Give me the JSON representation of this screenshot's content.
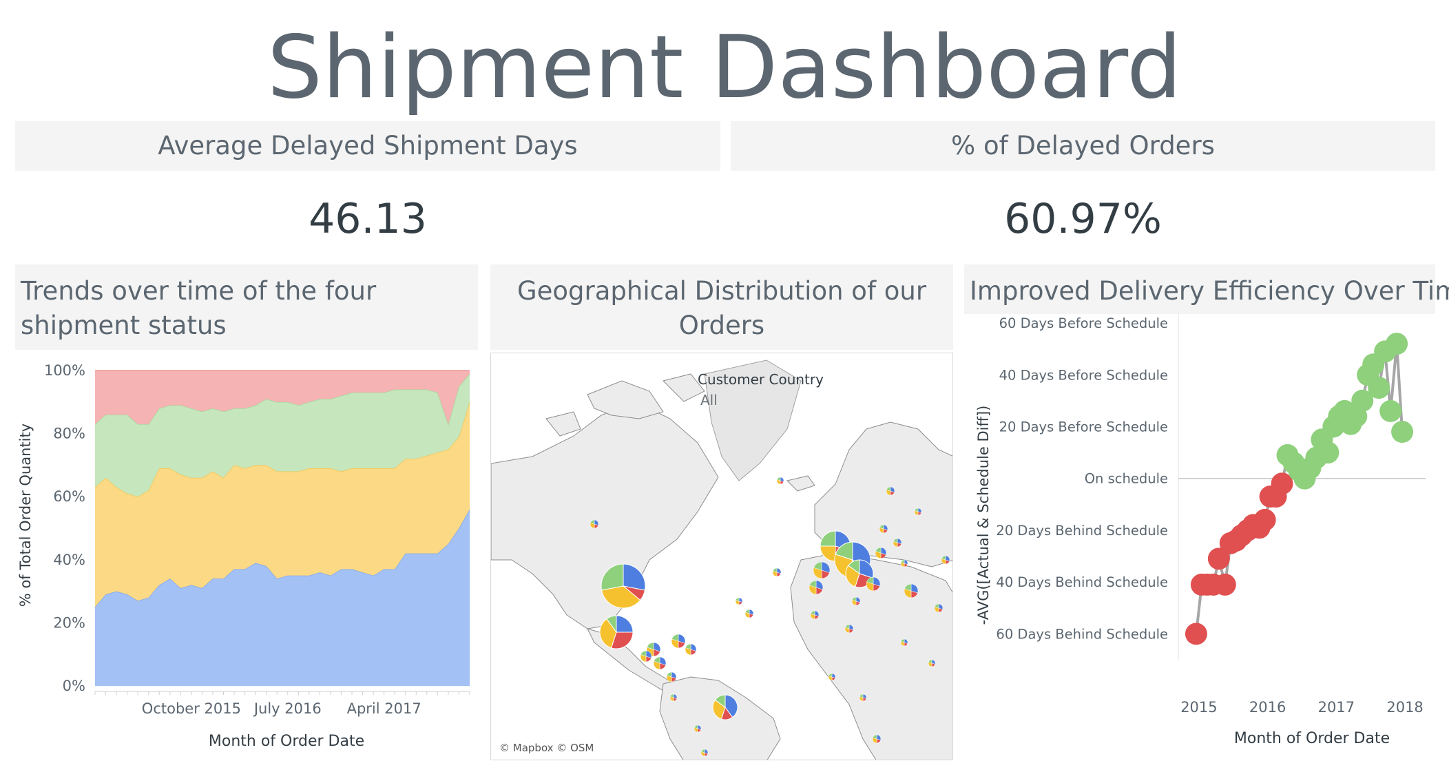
{
  "dashboard": {
    "title": "Shipment Dashboard"
  },
  "kpis": {
    "avg_delay": {
      "label": "Average Delayed Shipment Days",
      "value": "46.13"
    },
    "pct_delayed": {
      "label": "% of Delayed Orders",
      "value": "60.97%"
    }
  },
  "panels": {
    "trends": {
      "title": "Trends over time of the four shipment status"
    },
    "geo": {
      "title": "Geographical Distribution of our Orders"
    },
    "efficiency": {
      "title": "Improved Delivery Efficiency Over Time"
    }
  },
  "map": {
    "legend_title": "Customer Country",
    "legend_value": "All",
    "attribution": "© Mapbox © OSM",
    "slice_colors": [
      "#4e7fe0",
      "#e05050",
      "#f5c12e",
      "#8ed07c"
    ]
  },
  "chart_data": [
    {
      "type": "area",
      "stacked": true,
      "normalized": true,
      "ylabel": "% of Total Order Quantity",
      "xlabel": "Month of Order Date",
      "ylim": [
        0,
        100
      ],
      "yticks": [
        "0%",
        "20%",
        "40%",
        "60%",
        "80%",
        "100%"
      ],
      "xticks": [
        {
          "label": "October 2015",
          "index": 9
        },
        {
          "label": "July 2016",
          "index": 18
        },
        {
          "label": "April 2017",
          "index": 27
        }
      ],
      "n_points": 36,
      "series": [
        {
          "color": "#a3c1f5",
          "edge": "#7fa6ee",
          "values": [
            25,
            29,
            30,
            29,
            27,
            28,
            32,
            34,
            31,
            32,
            31,
            34,
            34,
            37,
            37,
            39,
            38,
            34,
            35,
            35,
            35,
            36,
            35,
            37,
            37,
            36,
            35,
            37,
            37,
            42,
            42,
            42,
            42,
            45,
            50,
            56
          ]
        },
        {
          "color": "#fbd985",
          "edge": "#f5c653",
          "values": [
            38,
            37,
            33,
            32,
            33,
            34,
            37,
            35,
            36,
            34,
            35,
            34,
            32,
            33,
            32,
            31,
            32,
            34,
            33,
            33,
            34,
            33,
            34,
            31,
            32,
            33,
            34,
            32,
            32,
            30,
            30,
            31,
            32,
            30,
            29,
            34
          ]
        },
        {
          "color": "#c6e6bd",
          "edge": "#a7d69b",
          "values": [
            20,
            20,
            23,
            25,
            23,
            21,
            19,
            20,
            22,
            22,
            21,
            20,
            21,
            18,
            19,
            19,
            21,
            22,
            22,
            21,
            21,
            22,
            22,
            24,
            24,
            24,
            24,
            24,
            25,
            22,
            22,
            21,
            19,
            8,
            16,
            9
          ]
        },
        {
          "color": "#f5b3b3",
          "edge": "#e89a9a",
          "values": [
            17,
            14,
            14,
            14,
            17,
            17,
            12,
            11,
            11,
            12,
            13,
            12,
            13,
            12,
            12,
            11,
            9,
            10,
            10,
            11,
            10,
            9,
            9,
            8,
            7,
            7,
            7,
            7,
            6,
            6,
            6,
            6,
            7,
            17,
            5,
            1
          ]
        }
      ],
      "grid": true
    },
    {
      "type": "scatter",
      "connected": true,
      "ylabel": "-AVG([Actual & Schedule Diff])",
      "xlabel": "Month of Order Date",
      "xticks": [
        {
          "label": "2015",
          "value": 2015.0
        },
        {
          "label": "2016",
          "value": 2016.0
        },
        {
          "label": "2017",
          "value": 2017.0
        },
        {
          "label": "2018",
          "value": 2018.0
        }
      ],
      "xlim": [
        2014.7,
        2018.3
      ],
      "yticks": [
        {
          "label": "60 Days Before Schedule",
          "value": 60
        },
        {
          "label": "40 Days Before Schedule",
          "value": 40
        },
        {
          "label": "20 Days Before Schedule",
          "value": 20
        },
        {
          "label": "On schedule",
          "value": 0
        },
        {
          "label": "20 Days Behind Schedule",
          "value": -20
        },
        {
          "label": "40 Days Behind Schedule",
          "value": -40
        },
        {
          "label": "60 Days Behind Schedule",
          "value": -60
        }
      ],
      "ylim": [
        -70,
        64
      ],
      "colors": {
        "positive": "#8ed07c",
        "negative": "#e05050",
        "line": "#a6a6a6",
        "zero": "#c8c8c8"
      },
      "points": [
        {
          "x": 2014.96,
          "y": -60
        },
        {
          "x": 2015.04,
          "y": -41
        },
        {
          "x": 2015.12,
          "y": -41
        },
        {
          "x": 2015.21,
          "y": -41
        },
        {
          "x": 2015.29,
          "y": -31
        },
        {
          "x": 2015.38,
          "y": -41
        },
        {
          "x": 2015.46,
          "y": -25
        },
        {
          "x": 2015.54,
          "y": -24
        },
        {
          "x": 2015.62,
          "y": -22
        },
        {
          "x": 2015.71,
          "y": -20
        },
        {
          "x": 2015.79,
          "y": -18
        },
        {
          "x": 2015.88,
          "y": -19
        },
        {
          "x": 2015.96,
          "y": -16
        },
        {
          "x": 2016.04,
          "y": -7
        },
        {
          "x": 2016.12,
          "y": -7
        },
        {
          "x": 2016.21,
          "y": -2
        },
        {
          "x": 2016.29,
          "y": 9
        },
        {
          "x": 2016.38,
          "y": 6
        },
        {
          "x": 2016.46,
          "y": 3
        },
        {
          "x": 2016.54,
          "y": 0
        },
        {
          "x": 2016.62,
          "y": 4
        },
        {
          "x": 2016.71,
          "y": 8
        },
        {
          "x": 2016.79,
          "y": 15
        },
        {
          "x": 2016.88,
          "y": 10
        },
        {
          "x": 2016.96,
          "y": 20
        },
        {
          "x": 2017.04,
          "y": 24
        },
        {
          "x": 2017.12,
          "y": 26
        },
        {
          "x": 2017.21,
          "y": 21
        },
        {
          "x": 2017.29,
          "y": 24
        },
        {
          "x": 2017.38,
          "y": 30
        },
        {
          "x": 2017.46,
          "y": 40
        },
        {
          "x": 2017.54,
          "y": 44
        },
        {
          "x": 2017.62,
          "y": 35
        },
        {
          "x": 2017.71,
          "y": 49
        },
        {
          "x": 2017.79,
          "y": 26
        },
        {
          "x": 2017.88,
          "y": 52
        },
        {
          "x": 2017.96,
          "y": 18
        }
      ]
    }
  ]
}
